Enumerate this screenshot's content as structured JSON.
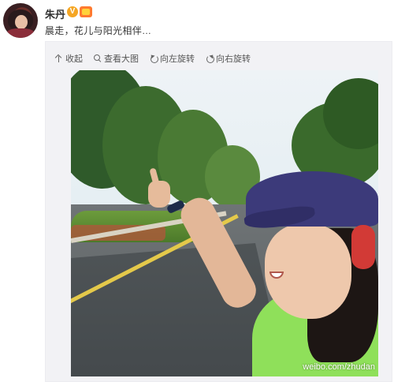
{
  "post": {
    "author": "朱丹",
    "text": "晨走，花儿与阳光相伴…",
    "verified_icon": "verified-v-icon",
    "vip_icon": "vip-crown-icon"
  },
  "toolbar": {
    "collapse_label": "收起",
    "view_large_label": "查看大图",
    "rotate_left_label": "向左旋转",
    "rotate_right_label": "向右旋转"
  },
  "photo": {
    "watermark": "weibo.com/zhudan"
  },
  "colors": {
    "author_name": "#333333",
    "media_bg": "#f2f2f5",
    "verified_badge": "#f5a623",
    "vip_badge": "#ff7a2f"
  }
}
